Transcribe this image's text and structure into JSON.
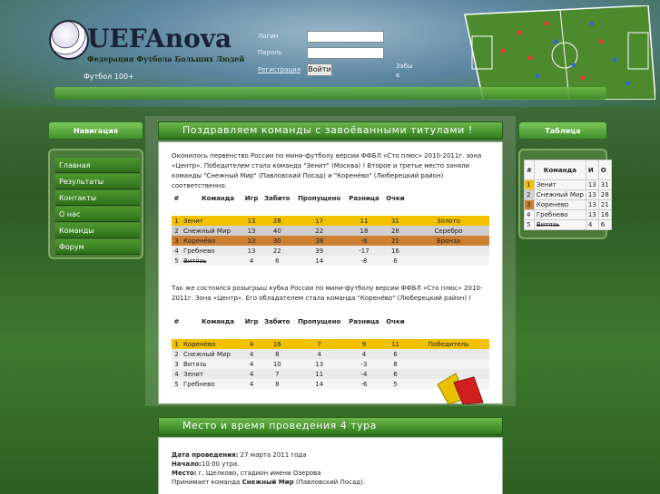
{
  "header": {
    "logo_text": "UEFAnova",
    "logo_sub": "Федерация Футбола Больших Людей",
    "login_label": "Логин",
    "password_label": "Пароль",
    "register_link": "Регистрация",
    "login_button": "Войти",
    "forgot_line1": "Забы",
    "forgot_line2": "в",
    "counter": "Футбол 100+"
  },
  "nav": {
    "title": "Навигация",
    "items": [
      "Главная",
      "Результаты",
      "Контакты",
      "О нас",
      "Команды",
      "Форум"
    ]
  },
  "right": {
    "title": "Таблица",
    "headers": [
      "#",
      "Команда",
      "И",
      "О"
    ],
    "rows": [
      [
        "1",
        "Зенит",
        "13",
        "31"
      ],
      [
        "2",
        "Снежный Мир",
        "13",
        "28"
      ],
      [
        "3",
        "Кореневo",
        "13",
        "21"
      ],
      [
        "4",
        "Гребнево",
        "13",
        "16"
      ],
      [
        "5",
        "Витязь",
        "4",
        "6"
      ]
    ]
  },
  "main": {
    "headline": "Поздравляем команды с завоёванными титулами !",
    "para1": "Оконилось первенство России по мини-футболу версии ФФБЛ «Сто плюс» 2010-2011г. зона «Центр». Победителем стала команда \"Зенит\" (Москва) ! Второе и третье место заняли команды \"Снежный Мир\" (Павловский Посад) и \"Коренёво\" (Люберецкий район) соответственно.",
    "table1": {
      "headers": [
        "#",
        "Команда",
        "Игр",
        "Забито",
        "Пропущено",
        "Разница",
        "Очки",
        ""
      ],
      "rows": [
        [
          "1",
          "Зенит",
          "13",
          "28",
          "17",
          "11",
          "31",
          "Золото"
        ],
        [
          "2",
          "Снежный Мир",
          "13",
          "40",
          "22",
          "18",
          "28",
          "Серебро"
        ],
        [
          "3",
          "Коренёво",
          "13",
          "30",
          "38",
          "-8",
          "21",
          "Бронза"
        ],
        [
          "4",
          "Гребнево",
          "13",
          "22",
          "39",
          "-17",
          "16",
          ""
        ],
        [
          "5",
          "Витязь",
          "4",
          "6",
          "14",
          "-8",
          "6",
          ""
        ]
      ]
    },
    "para2": "Так же состоялся розыгрыш кубка России по мини-футболу версии ФФБЛ «Сто плюс» 2010-2011г. Зона «Центр». Его обладателем стала команда \"Коренёво\" (Люберецкий район) !",
    "table2": {
      "headers": [
        "#",
        "Команда",
        "Игр",
        "Забито",
        "Пропущено",
        "Разница",
        "Очки",
        ""
      ],
      "rows": [
        [
          "1",
          "Коренёво",
          "4",
          "16",
          "7",
          "9",
          "11",
          "Победитель"
        ],
        [
          "2",
          "Снежный Мир",
          "4",
          "8",
          "4",
          "4",
          "6",
          ""
        ],
        [
          "3",
          "Витязь",
          "4",
          "10",
          "13",
          "-3",
          "8",
          ""
        ],
        [
          "4",
          "Зенит",
          "4",
          "7",
          "11",
          "-4",
          "6",
          ""
        ],
        [
          "5",
          "Гребнево",
          "4",
          "8",
          "14",
          "-6",
          "5",
          ""
        ]
      ]
    },
    "headline2": "Место и время проведения 4 тура",
    "date_label": "Дата проведения:",
    "date_value": " 27 марта 2011 года",
    "start_label": "Начало:",
    "start_value": "10:00 утра.",
    "place_label": "Место:",
    "place_value": " г. Щелково, стадион имени Озерова",
    "host_prefix": "Принимает команда ",
    "host_team": "Снежный Мир",
    "host_suffix": " (Павловский Посад)."
  }
}
